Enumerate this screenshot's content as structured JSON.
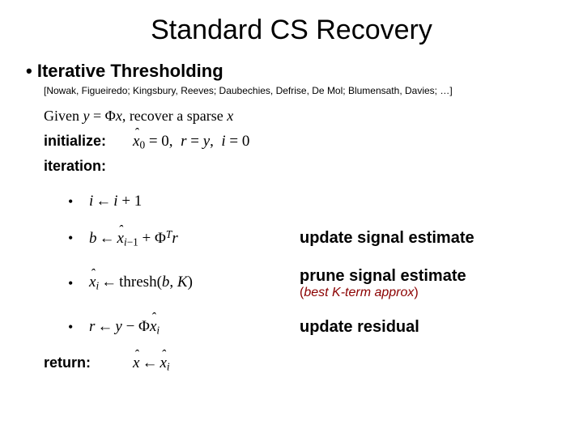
{
  "title": "Standard CS Recovery",
  "heading": "Iterative Thresholding",
  "citation": "[Nowak, Figueiredo; Kingsbury, Reeves; Daubechies, Defrise, De Mol; Blumensath, Davies; …]",
  "given_prefix": "Given ",
  "given_mid": ", recover a sparse ",
  "labels": {
    "initialize": "initialize:",
    "iteration": "iteration:",
    "return": "return:"
  },
  "comments": {
    "update_signal": "update signal estimate",
    "prune_signal": "prune signal estimate",
    "prune_sub_open": "(",
    "prune_sub_text": "best K-term approx",
    "prune_sub_close": ")",
    "update_residual": "update residual"
  }
}
